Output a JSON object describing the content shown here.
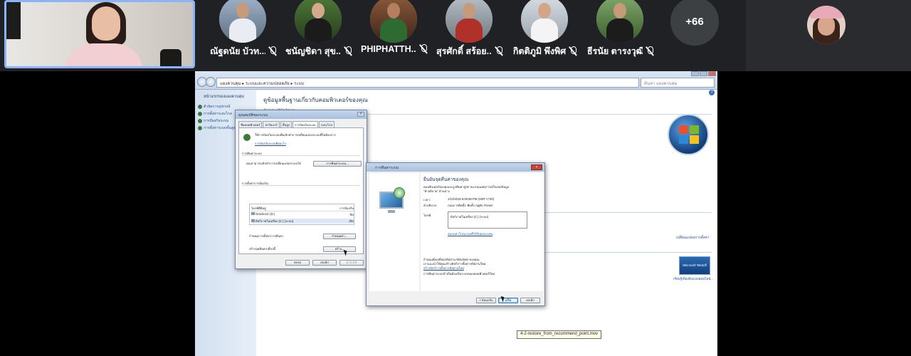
{
  "meet": {
    "participants": [
      {
        "name": "ณัฐดนัย บัวท...",
        "muted": true
      },
      {
        "name": "ชนัญชิดา สุข...",
        "muted": true
      },
      {
        "name": "PHIPHATTH...",
        "muted": true
      },
      {
        "name": "สุรศักดิ์ สร้อย...",
        "muted": true
      },
      {
        "name": "กิตติภูมิ พึงพิศ",
        "muted": true
      },
      {
        "name": "ธีรนัย ตารงวุฒิ",
        "muted": true
      }
    ],
    "more_count": "+66",
    "icons": {
      "mic": "mic-off-icon"
    }
  },
  "shared_screen": {
    "address": "แผงควบคุม ▸ ระบบและความปลอดภัย ▸ ระบบ",
    "search_placeholder": "ค้นหา แผงควบคุม",
    "left_panel": {
      "header": "หน้าแรกของแผงควบคุม",
      "links": [
        "ตัวจัดการอุปกรณ์",
        "การตั้งค่าระยะไกล",
        "การป้องกันระบบ",
        "การตั้งค่าระบบขั้นสูง"
      ]
    },
    "main": {
      "title": "ดูข้อมูลพื้นฐานเกี่ยวกับคอมพิวเตอร์ของคุณ",
      "subtitle": "รุ่นของ Windows",
      "side_link": "เปลี่ยนแปลงการตั้งค่า",
      "genuine_badge": "Microsoft ของแท้",
      "genuine_link": "เรียนรู้เพิ่มเติมแบบออนไลน์..."
    },
    "system_dialog": {
      "title": "คุณสมบัติของระบบ",
      "tabs": [
        "ชื่อคอมพิวเตอร์",
        "ฮาร์ดแวร์",
        "ขั้นสูง",
        "การป้องกันระบบ",
        "ระยะไกล"
      ],
      "intro": "ใช้การป้องกันระบบเพื่อเลิกทำการเปลี่ยนแปลงระบบที่ไม่ต้องการ",
      "intro_link": "การป้องกันระบบคืออะไร",
      "restore_group": "การคืนค่าระบบ",
      "restore_text": "คุณสามารถเลิกทำการเปลี่ยนแปลงระบบได้",
      "restore_button": "การคืนค่าระบบ...",
      "settings_group": "การตั้งค่าการป้องกัน",
      "col_drive": "ไดรฟ์ที่มีอยู่",
      "col_protect": "การป้องกัน",
      "drives": [
        {
          "name": "Oracle12c (D:)",
          "protection": "ปิด"
        },
        {
          "name": "ดิสก์ภายในเครื่อง (C:) (ระบบ)",
          "protection": "เปิด"
        }
      ],
      "configure_text": "กำหนดการตั้งค่าการคืนค่า",
      "configure_button": "กำหนดค่า...",
      "create_text": "สร้างจุดคืนค่าเดี๋ยวนี้",
      "create_button": "สร้าง...",
      "ok": "ตกลง",
      "cancel": "ยกเลิก",
      "apply": "นำไปใช้"
    },
    "restore_wizard": {
      "title": "การคืนค่าระบบ",
      "heading": "ยืนยันจุดคืนค่าของคุณ",
      "desc": "คอมพิวเตอร์ของคุณจะถูกคืนค่าสู่สถานะก่อนเหตุการณ์ในเขตข้อมูล",
      "desc2": "\"คำอธิบาย\" ด้านล่าง",
      "time_label": "เวลา:",
      "time_value": "1/12/2019 6:06:59 PM (GMT+7:00)",
      "desc_label": "คำอธิบาย:",
      "desc_value": "ถอนการติดตั้ง: ติดตั้ง Apple iTunes",
      "drives_label": "ไดรฟ์:",
      "drives_value": "ดิสก์ภายในเครื่อง (C:) (ระบบ)",
      "scan_link": "สแกนหาโปรแกรมที่ได้รับผลกระทบ",
      "note1": "ถ้าคุณเพิ่งเปลี่ยนรหัสผ่าน Windows ของคุณ",
      "note2": "เราแนะนำให้คุณสร้างดิสก์การตั้งค่ารหัสผ่านใหม่",
      "note_link": "สร้างดิสก์การตั้งค่ารหัสผ่านใหม่",
      "note3": "การคืนค่าระบบจำเป็นต้องเริ่มระบบของคอมพิวเตอร์ใหม่",
      "back": "< ย้อนกลับ",
      "finish": "เสร็จ",
      "cancel": "ยกเลิก"
    },
    "video_filename": "4-2-restore_from_recommend_point.mov"
  }
}
